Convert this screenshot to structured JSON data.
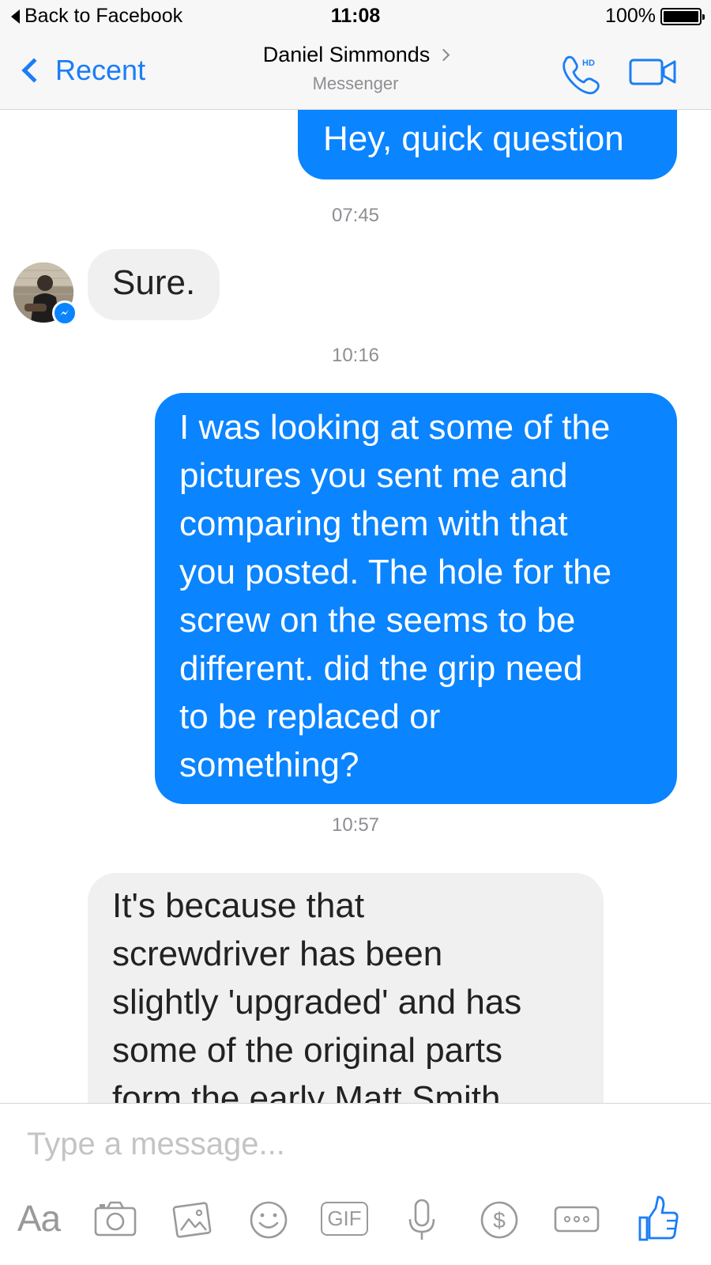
{
  "status_bar": {
    "back_label": "Back to Facebook",
    "time": "11:08",
    "battery": "100%",
    "battery_level": 1.0
  },
  "nav": {
    "back_label": "Recent",
    "contact_name": "Daniel Simmonds",
    "subtitle": "Messenger",
    "call_icon": "phone-hd-icon",
    "call_badge": "HD",
    "video_icon": "video-camera-icon"
  },
  "messages": [
    {
      "from": "me",
      "text": "Hey, quick question"
    },
    {
      "timestamp": "07:45"
    },
    {
      "from": "contact",
      "text": "Sure."
    },
    {
      "timestamp": "10:16"
    },
    {
      "from": "me",
      "lines": [
        "I was looking at some of the",
        "pictures you sent me and",
        "comparing them with that",
        "you posted. The hole for the",
        "screw on the seems to be",
        "different. did the grip need",
        "to be replaced or",
        "something?"
      ]
    },
    {
      "timestamp": "10:57"
    },
    {
      "from": "contact",
      "lines": [
        "It's because that",
        "screwdriver has been",
        "slightly 'upgraded' and has",
        "some of the original parts",
        "form the early Matt Smith"
      ]
    }
  ],
  "composer": {
    "placeholder": "Type a message...",
    "toolbar": {
      "text_style_label": "Aa",
      "camera_icon": "camera-icon",
      "photo_icon": "photo-gallery-icon",
      "emoji_icon": "smiley-icon",
      "gif_label": "GIF",
      "mic_icon": "microphone-icon",
      "payment_icon": "dollar-icon",
      "more_icon": "more-icon",
      "like_icon": "thumbs-up-icon"
    }
  },
  "colors": {
    "accent": "#1a7ef6",
    "outgoing_bubble": "#0a84ff",
    "incoming_bubble": "#f1f0f0",
    "timestamp": "#8e8e93",
    "toolbar_icon": "#9a9a9a"
  }
}
